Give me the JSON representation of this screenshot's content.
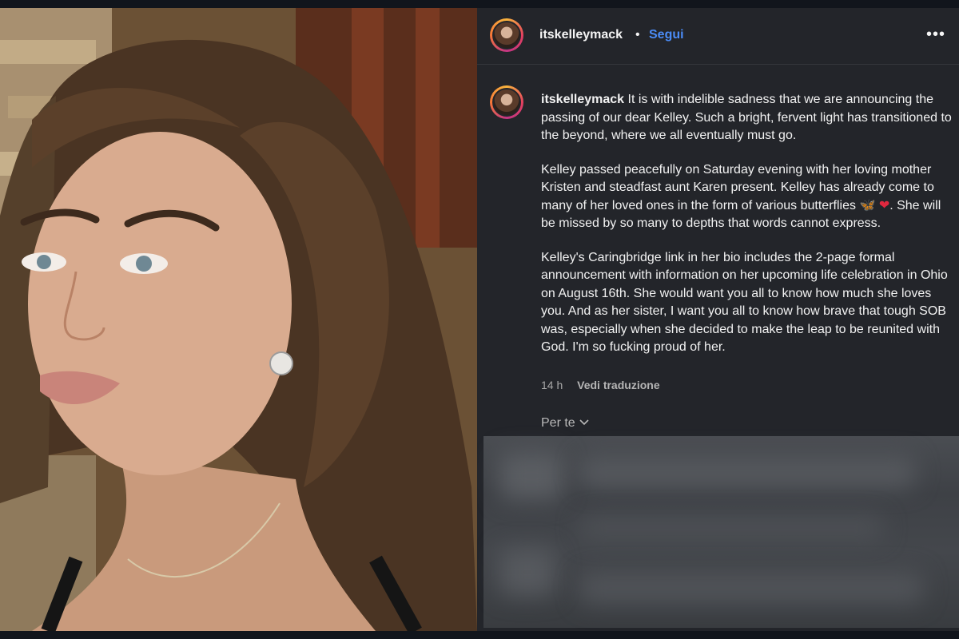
{
  "header": {
    "username": "itskelleymack",
    "separator": "•",
    "follow_label": "Segui",
    "more_icon": "more-icon"
  },
  "caption": {
    "username": "itskelleymack",
    "paragraph1": "It is with indelible sadness that we are announcing the passing of our dear Kelley. Such a bright, fervent light has transitioned to the beyond, where we all eventually must go.",
    "paragraph2_text": "Kelley passed peacefully on Saturday evening with her loving mother Kristen and steadfast aunt Karen present. Kelley has already come to many of her loved ones in the form of various butterflies",
    "paragraph2_emoji_butterfly": "🦋",
    "paragraph2_emoji_heart": "❤",
    "paragraph2_end": ". She will be missed by so many to depths that words cannot express.",
    "paragraph3": "Kelley's Caringbridge link in her bio includes the 2-page formal announcement with information on her upcoming life celebration in Ohio on August 16th. She would want you all to know how much she loves you. And as her sister, I want you all to know how brave that tough SOB was, especially when she decided to make the leap to be reunited with God. I'm so fucking proud of her."
  },
  "meta": {
    "time": "14 h",
    "translate_label": "Vedi traduzione"
  },
  "for_you": {
    "label": "Per te",
    "chevron_icon": "chevron-down-icon"
  },
  "colors": {
    "panel_bg": "#23252a",
    "follow_blue": "#4b8cf7",
    "page_bg": "#11151c"
  }
}
